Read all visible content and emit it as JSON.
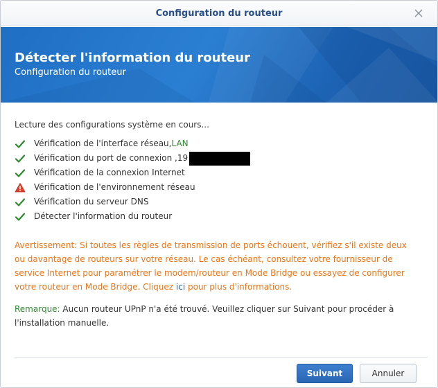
{
  "window": {
    "title": "Configuration du routeur"
  },
  "banner": {
    "title": "Détecter l'information du routeur",
    "subtitle": "Configuration du routeur"
  },
  "status_text": "Lecture des configurations système en cours...",
  "checks": [
    {
      "label": "Vérification de l'interface réseau, ",
      "value": "LAN",
      "status": "ok"
    },
    {
      "label": "Vérification du port de connexion , ",
      "value": "19",
      "status": "ok"
    },
    {
      "label": "Vérification de la connexion Internet",
      "status": "ok"
    },
    {
      "label": "Vérification de l'environnement réseau",
      "status": "warning"
    },
    {
      "label": "Vérification du serveur DNS",
      "status": "ok"
    },
    {
      "label": "Détecter l'information du routeur",
      "status": "ok"
    }
  ],
  "warning": {
    "text": "Avertissement: Si toutes les règles de transmission de ports échouent, vérifiez s'il existe deux ou davantage de routeurs sur votre réseau. Le cas échéant, consultez votre fournisseur de service Internet pour paramétrer le modem/routeur en Mode Bridge ou essayez de configurer votre routeur en Mode Bridge. Cliquez ",
    "link": "ici",
    "text_after": " pour plus d'informations."
  },
  "remark": {
    "label": "Remarque:",
    "text": " Aucun routeur UPnP n'a été trouvé. Veuillez cliquer sur Suivant pour procéder à l'installation manuelle."
  },
  "buttons": {
    "next": "Suivant",
    "cancel": "Annuler"
  },
  "colors": {
    "accent": "#2a67b5",
    "ok": "#2e8a2e",
    "warning": "#e8761a",
    "banner": "#1f6fc4"
  }
}
